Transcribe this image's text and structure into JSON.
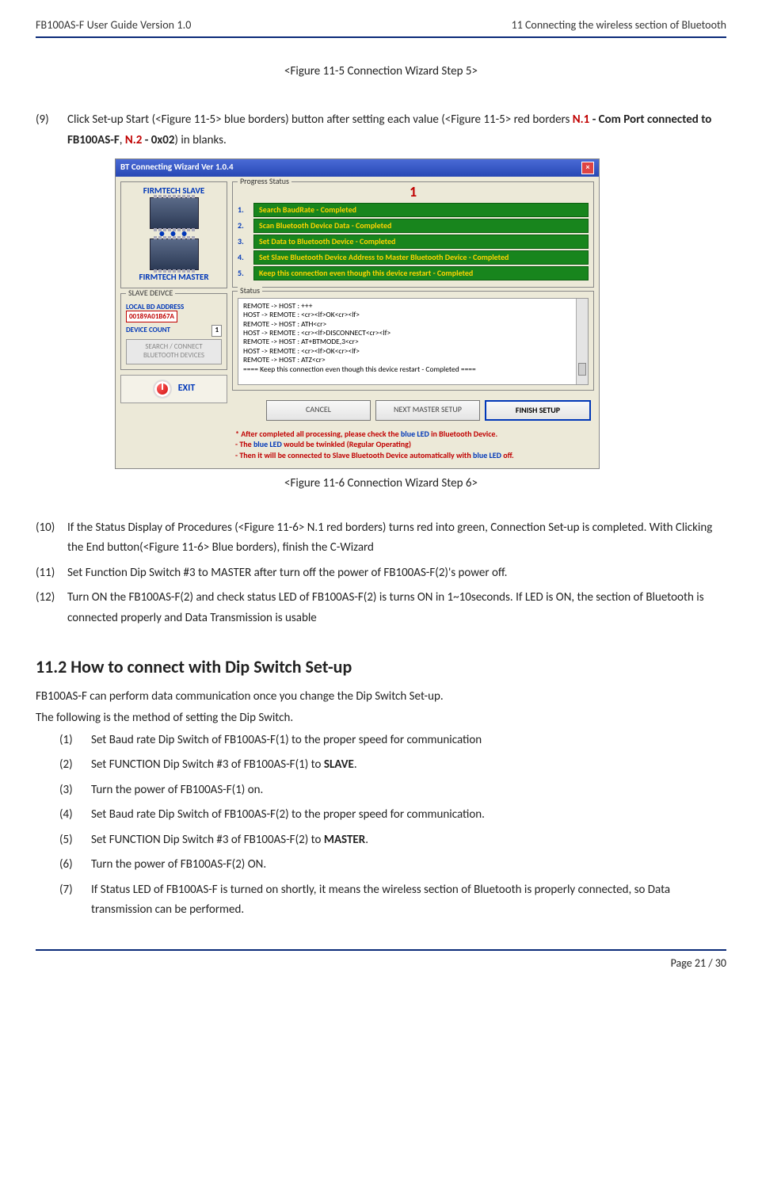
{
  "header": {
    "left": "FB100AS-F User Guide Version 1.0",
    "right": "11 Connecting the wireless section of Bluetooth"
  },
  "fig5_caption": "<Figure 11-5 Connection Wizard Step 5>",
  "step9": {
    "n": "(9)",
    "t_before": "Click Set-up Start (<Figure 11-5> blue borders) button after setting each value (<Figure 11-5> red borders ",
    "n1": "N.1",
    "dash1": " - ",
    "b1": "Com Port connected to FB100AS-F",
    "comma": ", ",
    "n2": "N.2",
    "dash2": " - ",
    "b2": "0x02",
    "t_after": ") in blanks."
  },
  "shot": {
    "title": "BT Connecting Wizard Ver 1.0.4",
    "slave": "FIRMTECH SLAVE",
    "master": "FIRMTECH MASTER",
    "grp_slave": "SLAVE DEIVCE",
    "bd_label": "LOCAL BD ADDRESS",
    "bd_value": "00189A01B67A",
    "dc_label": "DEVICE COUNT",
    "dc_value": "1",
    "faded": "SEARCH / CONNECT BLUETOOTH DEVICES",
    "exit": "EXIT",
    "grp_prog": "Progress Status",
    "red1": "1",
    "progress": [
      "Search BaudRate - Completed",
      "Scan Bluetooth Device Data - Completed",
      "Set Data to Bluetooth Device - Completed",
      "Set Slave Bluetooth Device Address to Master Bluetooth Device - Completed",
      "Keep this connection even though this device  restart - Completed"
    ],
    "grp_status": "Status",
    "status": [
      "REMOTE -> HOST : +++",
      "HOST -> REMOTE : <cr><lf>OK<cr><lf>",
      "REMOTE -> HOST : ATH<cr>",
      "HOST -> REMOTE : <cr><lf>DISCONNECT<cr><lf>",
      "REMOTE -> HOST : AT+BTMODE,3<cr>",
      "HOST -> REMOTE : <cr><lf>OK<cr><lf>",
      "REMOTE -> HOST : ATZ<cr>",
      "==== Keep this connection even though this device  restart - Completed ===="
    ],
    "btn_cancel": "CANCEL",
    "btn_next": "NEXT MASTER SETUP",
    "btn_finish": "FINISH SETUP",
    "note_l1a": "* After completed all processing, please check the ",
    "note_blue1": "blue LED",
    "note_l1b": " in Bluetooth Device.",
    "note_l2a": "  - The ",
    "note_blue2": "blue LED",
    "note_l2b": " would be twinkled (Regular Operating)",
    "note_l3a": "  - Then it will be connected to Slave Bluetooth Device automatically with ",
    "note_blue3": "blue LED",
    "note_l3b": " off."
  },
  "fig6_caption": "<Figure 11-6 Connection Wizard Step 6>",
  "step10": {
    "n": "(10)",
    "t": "If the Status Display of Procedures (<Figure 11-6> N.1 red borders) turns red into green, Connection Set-up is completed. With Clicking the End button(<Figure 11-6> Blue borders), finish the C-Wizard"
  },
  "step11": {
    "n": "(11)",
    "t": " Set Function Dip Switch #3 to MASTER after turn off the power of FB100AS-F(2)'s power off."
  },
  "step12": {
    "n": "(12)",
    "t": " Turn ON the FB100AS-F(2) and check status LED of FB100AS-F(2) is turns ON in 1~10seconds. If LED is ON, the section of Bluetooth is connected properly and Data Transmission is usable"
  },
  "sec11_2": "11.2 How to connect with Dip Switch Set-up",
  "sec_p1": "FB100AS-F can perform data communication once you change the Dip Switch Set-up.",
  "sec_p2": "The following is the method of setting the Dip Switch.",
  "list": {
    "i1": {
      "n": "(1)",
      "t": "Set Baud rate Dip Switch of FB100AS-F(1) to the proper speed for communication"
    },
    "i2": {
      "n": "(2)",
      "t_before": "Set FUNCTION Dip Switch #3 of FB100AS-F(1) to ",
      "b": "SLAVE",
      "t_after": "."
    },
    "i3": {
      "n": "(3)",
      "t": "Turn the power of FB100AS-F(1) on."
    },
    "i4": {
      "n": "(4)",
      "t": "Set Baud rate Dip Switch of FB100AS-F(2) to the proper speed for communication."
    },
    "i5": {
      "n": "(5)",
      "t_before": "Set FUNCTION Dip Switch #3 of FB100AS-F(2) to ",
      "b": "MASTER",
      "t_after": "."
    },
    "i6": {
      "n": "(6)",
      "t": "Turn the power of FB100AS-F(2) ON."
    },
    "i7": {
      "n": "(7)",
      "t": "If Status LED of FB100AS-F is turned on shortly, it means the wireless section of Bluetooth is properly connected, so Data transmission can be performed."
    }
  },
  "footer": "Page 21 / 30"
}
